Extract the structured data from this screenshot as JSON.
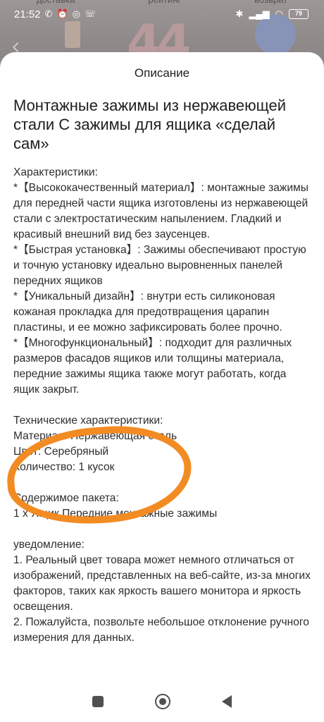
{
  "background_app": {
    "tabs": [
      "доставка",
      "рейтинг",
      "возврат"
    ]
  },
  "status_bar": {
    "time": "21:52",
    "battery": "79"
  },
  "sheet": {
    "title": "Описание",
    "product_title": "Монтажные зажимы из нержавеющей стали C зажимы для ящика «сделай сам»",
    "paragraphs": [
      "Характеристики:",
      "*【Высококачественный материал】: монтажные зажимы для передней части ящика изготовлены из нержавеющей стали с электростатическим напылением. Гладкий и красивый внешний вид без заусенцев.",
      "*【Быстрая установка】: Зажимы обеспечивают простую и точную установку идеально выровненных панелей передних ящиков",
      "*【Уникальный дизайн】: внутри есть силиконовая кожаная прокладка для предотвращения царапин пластины, и ее можно зафиксировать более прочно.",
      "*【Многофункциональный】: подходит для различных размеров фасадов ящиков или толщины материала, передние зажимы ящика также могут работать, когда ящик закрыт.",
      "",
      "Технические характеристики:",
      "Материал: Нержавеющая сталь",
      "Цвет: Серебряный",
      "Количество: 1 кусок",
      "",
      "Содержимое пакета:",
      "1 x Ящик Передние монтажные зажимы",
      "",
      "уведомление:",
      "1. Реальный цвет товара может немного отличаться от изображений, представленных на веб-сайте, из-за многих факторов, таких как яркость вашего монитора и яркость освещения.",
      "2. Пожалуйста, позвольте небольшое отклонение ручного измерения для данных."
    ]
  },
  "annotation": {
    "color": "#f38b23"
  },
  "nav_bar": {
    "icons": [
      "recents-square-icon",
      "home-circle-icon",
      "back-triangle-icon"
    ]
  }
}
